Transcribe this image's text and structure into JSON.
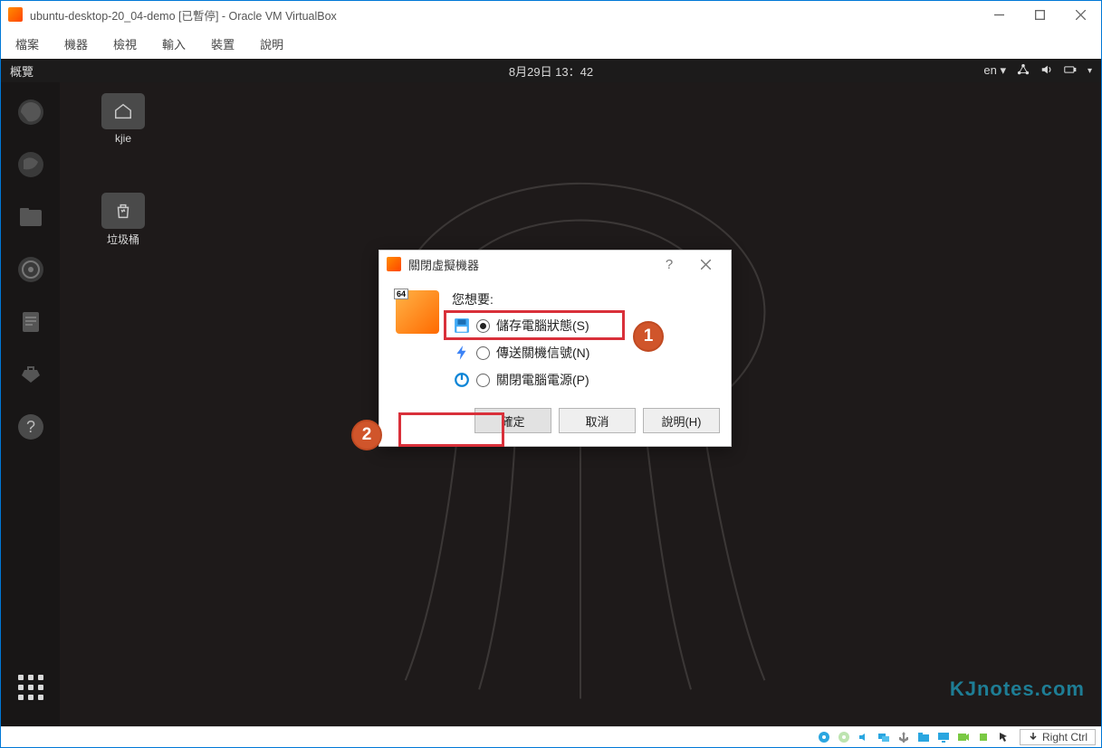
{
  "window": {
    "title": "ubuntu-desktop-20_04-demo [已暫停] - Oracle VM VirtualBox"
  },
  "menubar": [
    "檔案",
    "機器",
    "檢視",
    "輸入",
    "裝置",
    "說明"
  ],
  "ubuntu": {
    "top_left": "概覽",
    "clock": "8月29日  13：42",
    "lang": "en",
    "desktop_icons": [
      {
        "label": "kjie"
      },
      {
        "label": "垃圾桶"
      }
    ]
  },
  "dialog": {
    "title": "關閉虛擬機器",
    "badge64": "64",
    "prompt": "您想要:",
    "options": [
      {
        "label": "儲存電腦狀態(S)",
        "checked": true,
        "icon": "disk"
      },
      {
        "label": "傳送關機信號(N)",
        "checked": false,
        "icon": "bolt"
      },
      {
        "label": "關閉電腦電源(P)",
        "checked": false,
        "icon": "power"
      }
    ],
    "buttons": {
      "ok": "確定",
      "cancel": "取消",
      "help": "說明(H)"
    }
  },
  "annotations": {
    "one": "1",
    "two": "2"
  },
  "statusbar": {
    "hostkey": "Right Ctrl"
  },
  "watermark": "KJnotes.com"
}
